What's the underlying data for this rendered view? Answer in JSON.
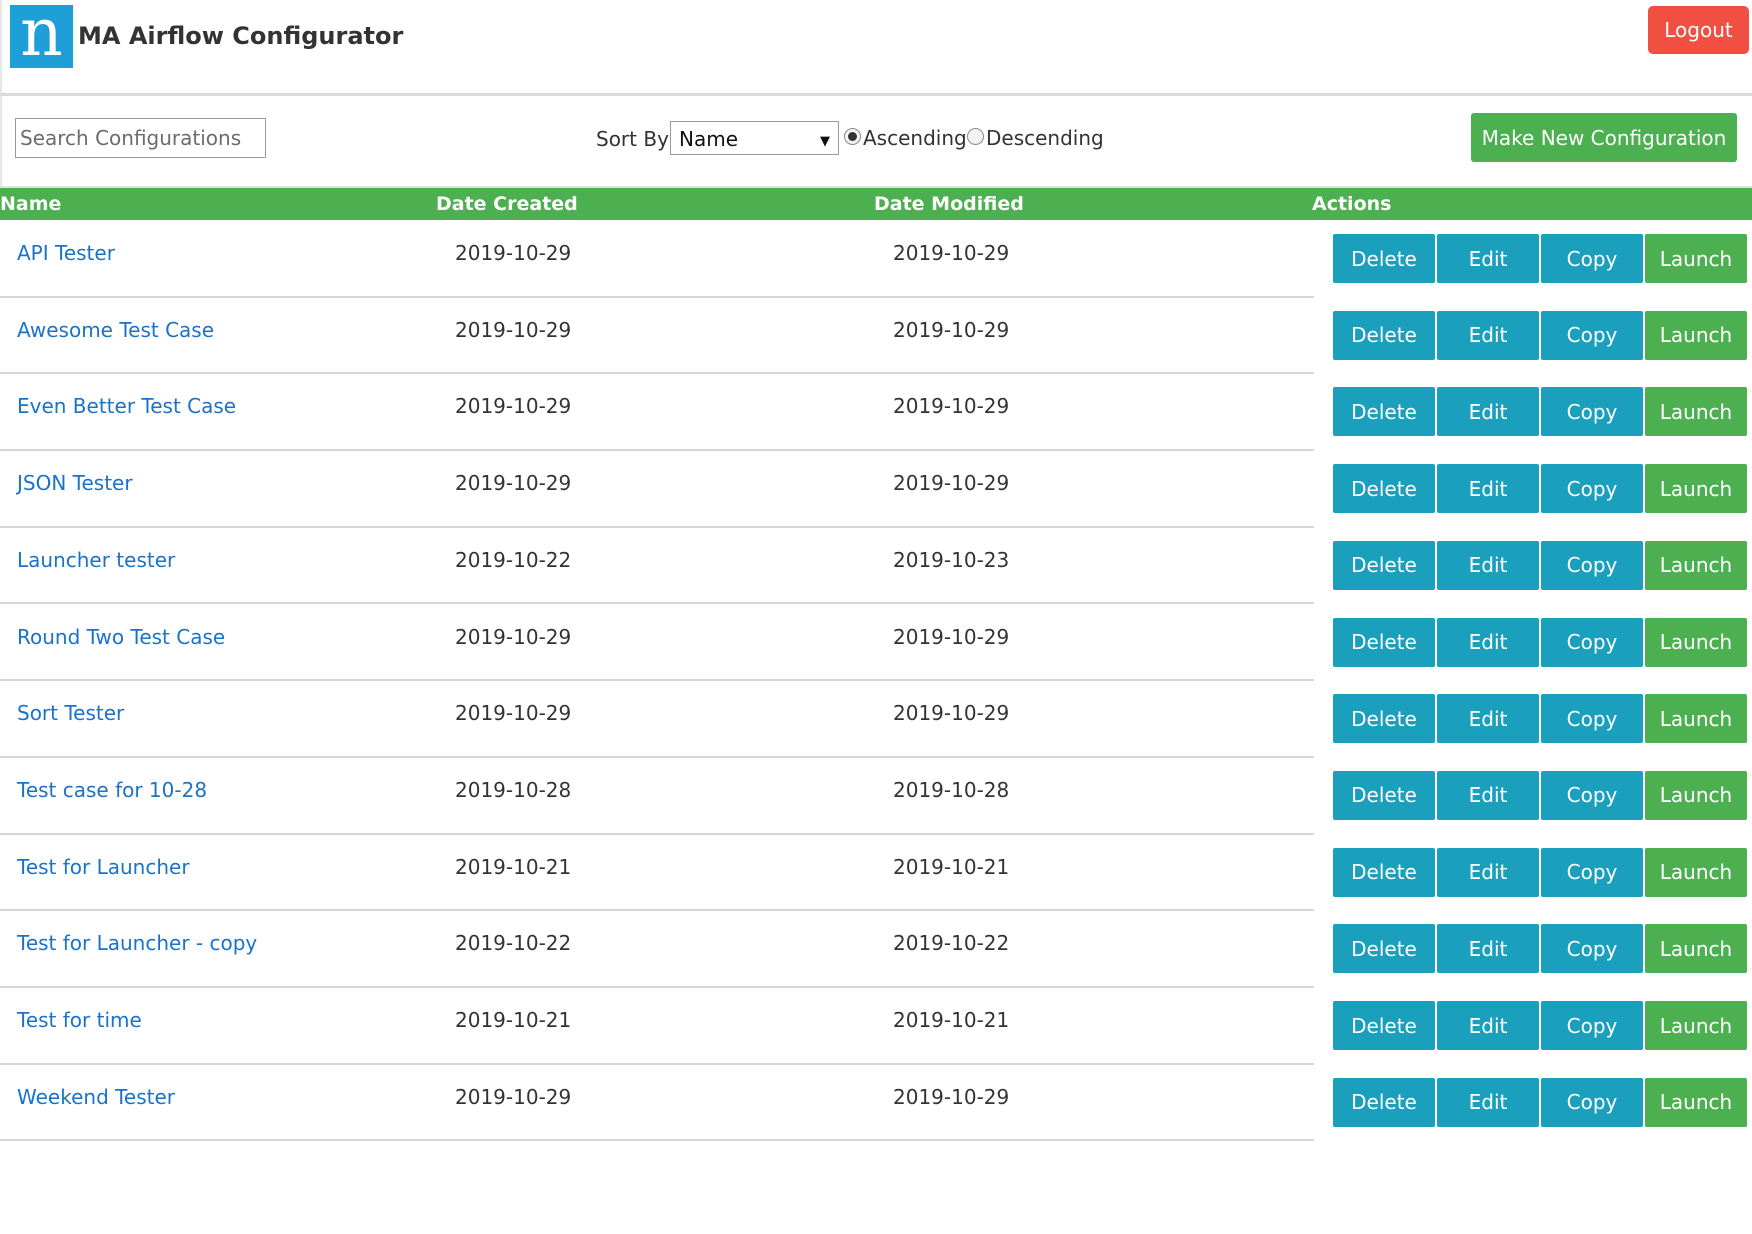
{
  "header": {
    "logo_glyph": "n",
    "title": "MA Airflow Configurator",
    "logout_label": "Logout"
  },
  "toolbar": {
    "search_placeholder": "Search Configurations",
    "search_value": "",
    "sort_label": "Sort By",
    "sort_value": "Name",
    "order_options": [
      {
        "label": "Ascending",
        "checked": true
      },
      {
        "label": "Descending",
        "checked": false
      }
    ],
    "new_config_label": "Make New Configuration"
  },
  "table": {
    "columns": [
      "Name",
      "Date Created",
      "Date Modified",
      "Actions"
    ],
    "actions": [
      "Delete",
      "Edit",
      "Copy",
      "Launch"
    ],
    "rows": [
      {
        "name": "API Tester",
        "created": "2019-10-29",
        "modified": "2019-10-29"
      },
      {
        "name": "Awesome Test Case",
        "created": "2019-10-29",
        "modified": "2019-10-29"
      },
      {
        "name": "Even Better Test Case",
        "created": "2019-10-29",
        "modified": "2019-10-29"
      },
      {
        "name": "JSON Tester",
        "created": "2019-10-29",
        "modified": "2019-10-29"
      },
      {
        "name": "Launcher tester",
        "created": "2019-10-22",
        "modified": "2019-10-23"
      },
      {
        "name": "Round Two Test Case",
        "created": "2019-10-29",
        "modified": "2019-10-29"
      },
      {
        "name": "Sort Tester",
        "created": "2019-10-29",
        "modified": "2019-10-29"
      },
      {
        "name": "Test case for 10-28",
        "created": "2019-10-28",
        "modified": "2019-10-28"
      },
      {
        "name": "Test for Launcher",
        "created": "2019-10-21",
        "modified": "2019-10-21"
      },
      {
        "name": "Test for Launcher - copy",
        "created": "2019-10-22",
        "modified": "2019-10-22"
      },
      {
        "name": "Test for time",
        "created": "2019-10-21",
        "modified": "2019-10-21"
      },
      {
        "name": "Weekend Tester",
        "created": "2019-10-29",
        "modified": "2019-10-29"
      }
    ]
  },
  "colors": {
    "accent_green": "#4caf50",
    "action_teal": "#1a9fbd",
    "logout_red": "#f24f43",
    "link_blue": "#1a73c9",
    "logo_blue": "#1e9fd8"
  }
}
